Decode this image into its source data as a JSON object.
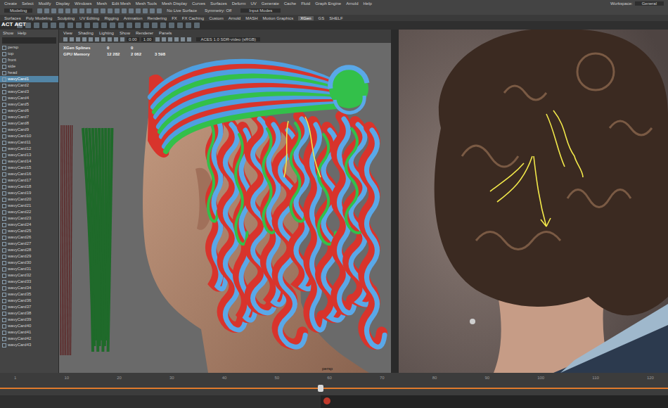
{
  "menu_bar": {
    "items": [
      "Create",
      "Select",
      "Modify",
      "Display",
      "Windows",
      "Mesh",
      "Edit Mesh",
      "Mesh Tools",
      "Mesh Display",
      "Curves",
      "Surfaces",
      "Deform",
      "UV",
      "Generate",
      "Cache",
      "Fluid",
      "Graph Engine",
      "Arnold",
      "Help"
    ],
    "workspace_label": "Workspace:",
    "workspace_value": "General"
  },
  "status_line": {
    "mode": "Modeling",
    "live_surface": "No Live Surface",
    "symmetry": "Symmetry: Off",
    "input": "Input Modes"
  },
  "shelf": {
    "tabs": [
      {
        "label": "Surfaces",
        "selected": false
      },
      {
        "label": "Poly Modeling",
        "selected": false
      },
      {
        "label": "Sculpting",
        "selected": false
      },
      {
        "label": "UV Editing",
        "selected": false
      },
      {
        "label": "Rigging",
        "selected": false
      },
      {
        "label": "Animation",
        "selected": false
      },
      {
        "label": "Rendering",
        "selected": false
      },
      {
        "label": "FX",
        "selected": false
      },
      {
        "label": "FX Caching",
        "selected": false
      },
      {
        "label": "Custom",
        "selected": false
      },
      {
        "label": "Arnold",
        "selected": false
      },
      {
        "label": "MASH",
        "selected": false
      },
      {
        "label": "Motion Graphics",
        "selected": false
      },
      {
        "label": "XGen",
        "selected": true
      },
      {
        "label": "GS",
        "selected": false
      },
      {
        "label": "SHELF",
        "selected": false
      }
    ]
  },
  "logo": [
    "ACT",
    "ACT"
  ],
  "outliner": {
    "menu": [
      "Show",
      "Help"
    ],
    "items": [
      {
        "label": "persp",
        "selected": false
      },
      {
        "label": "top",
        "selected": false
      },
      {
        "label": "front",
        "selected": false
      },
      {
        "label": "side",
        "selected": false
      },
      {
        "label": "head",
        "selected": false
      },
      {
        "label": "wavyCard1",
        "selected": true
      },
      {
        "label": "wavyCard2",
        "selected": false
      },
      {
        "label": "wavyCard3",
        "selected": false
      },
      {
        "label": "wavyCard4",
        "selected": false
      },
      {
        "label": "wavyCard5",
        "selected": false
      },
      {
        "label": "wavyCard6",
        "selected": false
      },
      {
        "label": "wavyCard7",
        "selected": false
      },
      {
        "label": "wavyCard8",
        "selected": false
      },
      {
        "label": "wavyCard9",
        "selected": false
      },
      {
        "label": "wavyCard10",
        "selected": false
      },
      {
        "label": "wavyCard11",
        "selected": false
      },
      {
        "label": "wavyCard12",
        "selected": false
      },
      {
        "label": "wavyCard13",
        "selected": false
      },
      {
        "label": "wavyCard14",
        "selected": false
      },
      {
        "label": "wavyCard15",
        "selected": false
      },
      {
        "label": "wavyCard16",
        "selected": false
      },
      {
        "label": "wavyCard17",
        "selected": false
      },
      {
        "label": "wavyCard18",
        "selected": false
      },
      {
        "label": "wavyCard19",
        "selected": false
      },
      {
        "label": "wavyCard20",
        "selected": false
      },
      {
        "label": "wavyCard21",
        "selected": false
      },
      {
        "label": "wavyCard22",
        "selected": false
      },
      {
        "label": "wavyCard23",
        "selected": false
      },
      {
        "label": "wavyCard24",
        "selected": false
      },
      {
        "label": "wavyCard25",
        "selected": false
      },
      {
        "label": "wavyCard26",
        "selected": false
      },
      {
        "label": "wavyCard27",
        "selected": false
      },
      {
        "label": "wavyCard28",
        "selected": false
      },
      {
        "label": "wavyCard29",
        "selected": false
      },
      {
        "label": "wavyCard30",
        "selected": false
      },
      {
        "label": "wavyCard31",
        "selected": false
      },
      {
        "label": "wavyCard32",
        "selected": false
      },
      {
        "label": "wavyCard33",
        "selected": false
      },
      {
        "label": "wavyCard34",
        "selected": false
      },
      {
        "label": "wavyCard35",
        "selected": false
      },
      {
        "label": "wavyCard36",
        "selected": false
      },
      {
        "label": "wavyCard37",
        "selected": false
      },
      {
        "label": "wavyCard38",
        "selected": false
      },
      {
        "label": "wavyCard39",
        "selected": false
      },
      {
        "label": "wavyCard40",
        "selected": false
      },
      {
        "label": "wavyCard41",
        "selected": false
      },
      {
        "label": "wavyCard42",
        "selected": false
      },
      {
        "label": "wavyCard43",
        "selected": false
      }
    ]
  },
  "viewport": {
    "menu": [
      "View",
      "Shading",
      "Lighting",
      "Show",
      "Renderer",
      "Panels"
    ],
    "fields": [
      "0.00",
      "1.00"
    ],
    "color_space": "ACES 1.0 SDR-video (sRGB)",
    "hud": [
      {
        "label": "XGen Splines",
        "values": [
          "0",
          "0"
        ]
      },
      {
        "label": "GPU Memory",
        "values": [
          "12 282",
          "2 062",
          "3 598"
        ]
      }
    ],
    "camera": "persp"
  },
  "timeline": {
    "ticks": [
      "1",
      "10",
      "20",
      "30",
      "40",
      "50",
      "60",
      "70",
      "80",
      "90",
      "100",
      "110",
      "120"
    ],
    "level": 0.48
  }
}
